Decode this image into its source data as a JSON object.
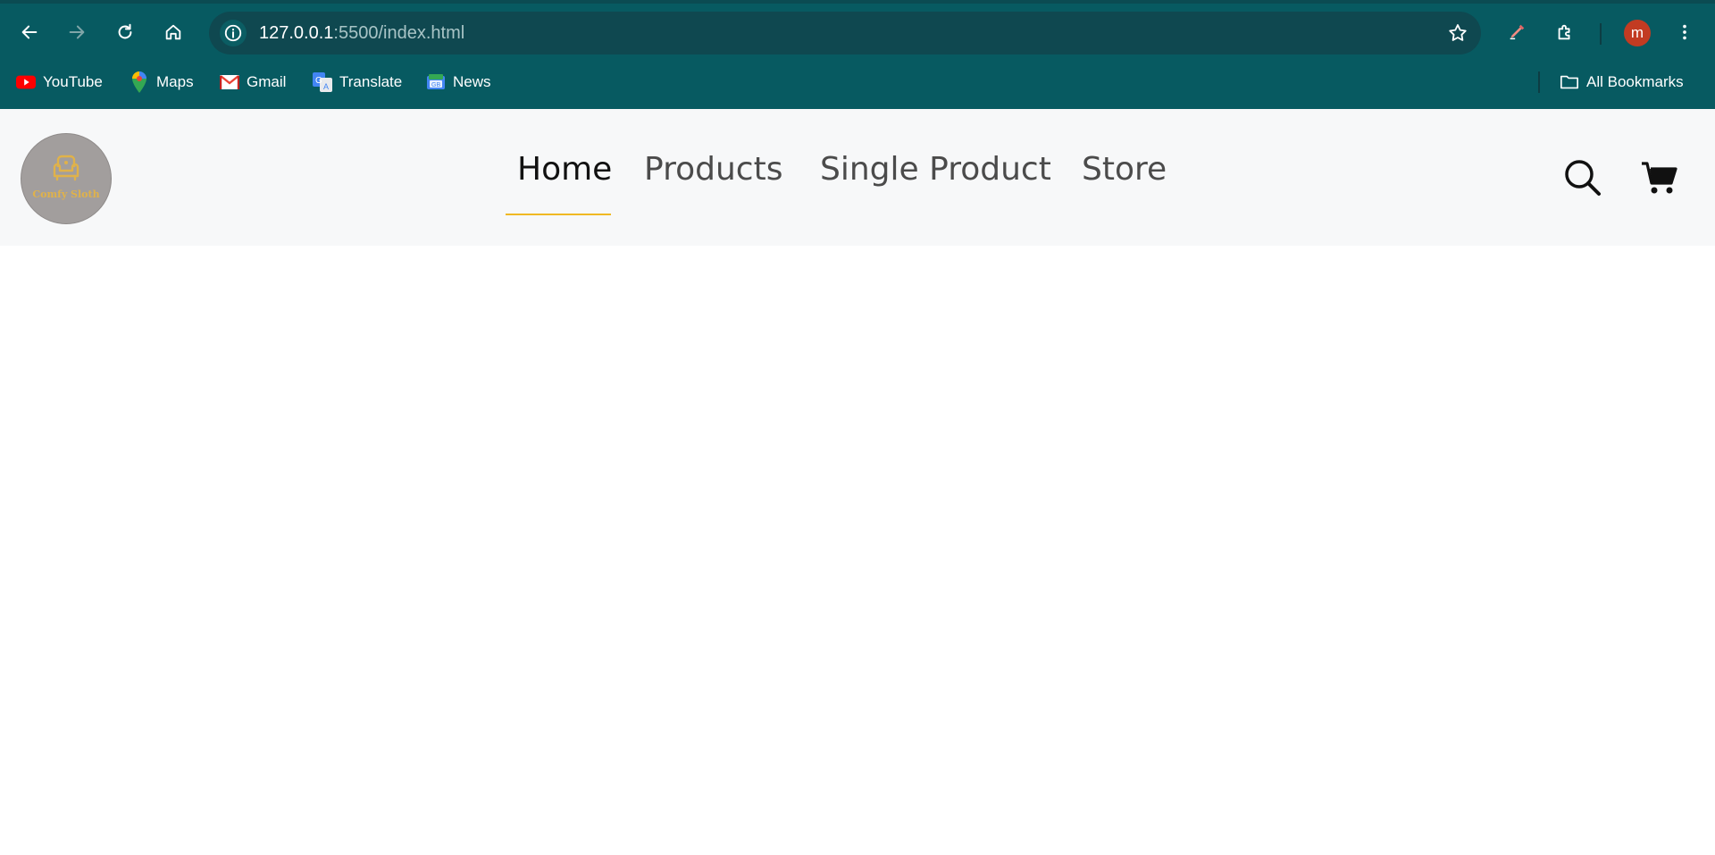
{
  "browser": {
    "url_host": "127.0.0.1",
    "url_path": ":5500/index.html",
    "profile_initial": "m",
    "colors": {
      "frame": "#075a61",
      "omnibox": "#0f4850",
      "avatar": "#c23b22"
    },
    "bookmarks": [
      {
        "label": "YouTube",
        "icon": "youtube-icon"
      },
      {
        "label": "Maps",
        "icon": "maps-pin-icon"
      },
      {
        "label": "Gmail",
        "icon": "gmail-icon"
      },
      {
        "label": "Translate",
        "icon": "translate-icon"
      },
      {
        "label": "News",
        "icon": "news-icon"
      }
    ],
    "all_bookmarks_label": "All Bookmarks"
  },
  "site": {
    "logo_text": "Comfy Sloth",
    "nav": [
      {
        "label": "Home",
        "active": true
      },
      {
        "label": "Products",
        "active": false
      },
      {
        "label": "Single Product",
        "active": false
      },
      {
        "label": "Store",
        "active": false
      }
    ],
    "accent_color": "#f0b923"
  }
}
